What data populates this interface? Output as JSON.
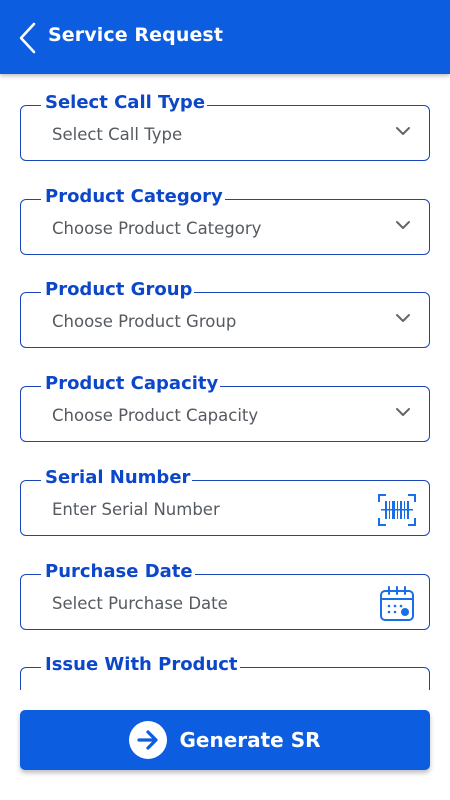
{
  "header": {
    "title": "Service Request",
    "back_icon": "chevron-left-icon"
  },
  "colors": {
    "primary": "#0d5de0",
    "label": "#0d47c9",
    "border": "#1a44b8",
    "placeholder": "#555a60"
  },
  "form": {
    "fields": [
      {
        "label": "Select Call Type",
        "value": "Select Call Type",
        "icon": "chevron-down-icon"
      },
      {
        "label": "Product Category",
        "value": "Choose Product Category",
        "icon": "chevron-down-icon"
      },
      {
        "label": "Product Group",
        "value": "Choose Product Group",
        "icon": "chevron-down-icon"
      },
      {
        "label": "Product Capacity",
        "value": "Choose Product Capacity",
        "icon": "chevron-down-icon"
      },
      {
        "label": "Serial Number",
        "value": "Enter Serial Number",
        "icon": "barcode-scan-icon"
      },
      {
        "label": "Purchase Date",
        "value": "Select Purchase Date",
        "icon": "calendar-icon"
      },
      {
        "label": "Issue With Product",
        "value": "",
        "icon": ""
      }
    ]
  },
  "footer": {
    "button_label": "Generate SR",
    "button_icon": "arrow-right-circle-icon"
  }
}
